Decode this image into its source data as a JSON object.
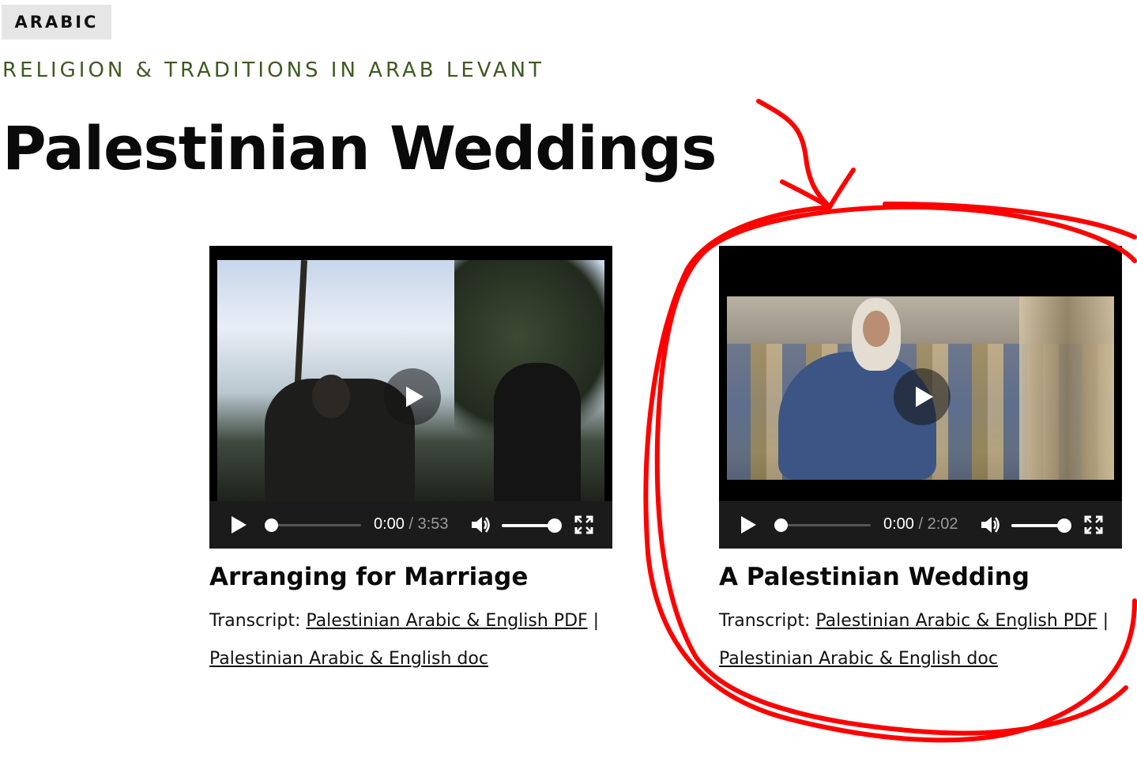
{
  "tag": "ARABIC",
  "category": "RELIGION & TRADITIONS IN ARAB LEVANT",
  "page_title": "Palestinian Weddings",
  "videos": [
    {
      "title": "Arranging for Marriage",
      "current_time": "0:00",
      "separator": "/",
      "duration": "3:53",
      "transcript_label": "Transcript:",
      "pdf_link": "Palestinian Arabic & English PDF",
      "divider": "|",
      "doc_link": "Palestinian Arabic & English doc"
    },
    {
      "title": "A Palestinian Wedding",
      "current_time": "0:00",
      "separator": "/",
      "duration": "2:02",
      "transcript_label": "Transcript:",
      "pdf_link": "Palestinian Arabic & English PDF",
      "divider": "|",
      "doc_link": "Palestinian Arabic & English doc"
    }
  ],
  "icons": {
    "play": "play-icon",
    "volume": "volume-icon",
    "fullscreen": "fullscreen-icon"
  },
  "colors": {
    "category_text": "#3f5a22",
    "annotation": "#ff0000",
    "controls_bg": "#1b1b1b"
  }
}
